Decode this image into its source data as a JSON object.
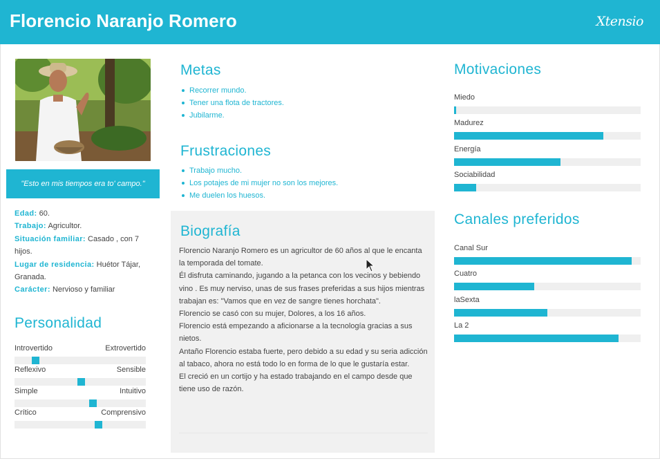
{
  "header": {
    "title": "Florencio Naranjo Romero",
    "brand": "Xtensio"
  },
  "profile": {
    "quote": "\"Esto en mis tiempos era to' campo.\"",
    "info": [
      {
        "label": "Edad:",
        "value": "60."
      },
      {
        "label": "Trabajo:",
        "value": "Agricultor."
      },
      {
        "label": "Situación familiar:",
        "value": "Casado , con 7 hijos."
      },
      {
        "label": "Lugar de residencia:",
        "value": "Huétor Tájar, Granada."
      },
      {
        "label": "Carácter:",
        "value": "Nervioso y familiar"
      }
    ]
  },
  "personality": {
    "title": "Personalidad",
    "traits": [
      {
        "left": "Introvertido",
        "right": "Extrovertido",
        "value": 0.13
      },
      {
        "left": "Reflexivo",
        "right": "Sensible",
        "value": 0.48
      },
      {
        "left": "Simple",
        "right": "Intuitivo",
        "value": 0.57
      },
      {
        "left": "Crítico",
        "right": "Comprensivo",
        "value": 0.61
      }
    ]
  },
  "goals": {
    "title": "Metas",
    "items": [
      "Recorrer mundo.",
      "Tener una flota de tractores.",
      "Jubilarme."
    ]
  },
  "frustrations": {
    "title": "Frustraciones",
    "items": [
      "Trabajo mucho.",
      "Los potajes de mi mujer no son los mejores.",
      "Me duelen los huesos."
    ]
  },
  "biography": {
    "title": "Biografía",
    "paragraphs": [
      "Florencio Naranjo Romero es un agricultor de 60 años al que le encanta la temporada del tomate.",
      "Él disfruta caminando, jugando a la petanca con los vecinos y bebiendo vino . Es muy nerviso, unas de sus frases preferidas a sus hijos mientras trabajan es: \"Vamos que en vez de sangre tienes horchata\".",
      "Florencio se casó con su mujer, Dolores, a los 16 años.",
      "Florencio está empezando a aficionarse a la tecnología gracias a sus nietos.",
      "Antaño Florencio estaba fuerte, pero debido a su edad y su seria adicción al tabaco, ahora no está todo lo en forma de lo que le gustaría estar.",
      "El creció en un cortijo y ha estado trabajando en el campo desde que tiene uso de razón."
    ]
  },
  "motivations": {
    "title": "Motivaciones",
    "items": [
      {
        "label": "Miedo",
        "value": 0.01
      },
      {
        "label": "Madurez",
        "value": 0.8
      },
      {
        "label": "Energía",
        "value": 0.57
      },
      {
        "label": "Sociabilidad",
        "value": 0.12
      }
    ]
  },
  "channels": {
    "title": "Canales preferidos",
    "items": [
      {
        "label": "Canal Sur",
        "value": 0.95
      },
      {
        "label": "Cuatro",
        "value": 0.43
      },
      {
        "label": "laSexta",
        "value": 0.5
      },
      {
        "label": "La 2",
        "value": 0.88
      }
    ]
  },
  "colors": {
    "accent": "#1fb5d2",
    "track": "#efefef",
    "bio_bg": "#f1f1f1"
  }
}
